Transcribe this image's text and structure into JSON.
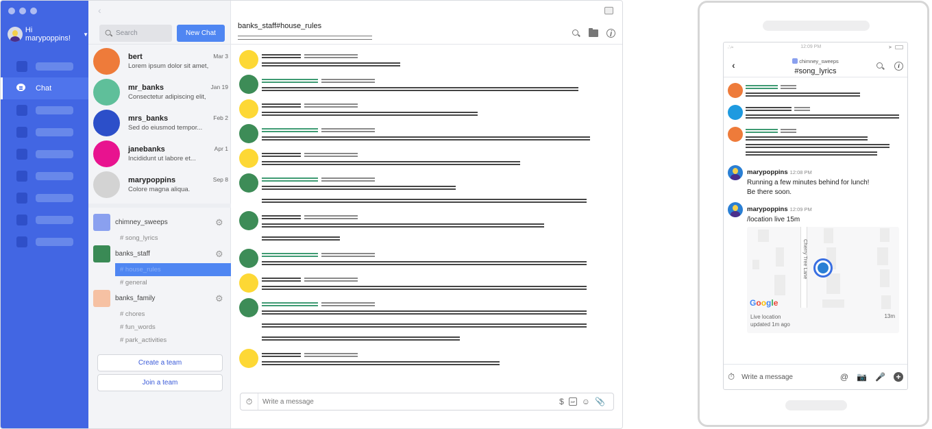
{
  "desktop": {
    "nav": {
      "greeting": "Hi marypoppins!",
      "active_label": "Chat",
      "placeholder_item_count": 9
    },
    "convos": {
      "search_placeholder": "Search",
      "new_chat_label": "New Chat",
      "items": [
        {
          "name": "bert",
          "preview": "Lorem ipsum dolor sit amet,",
          "date": "Mar 3",
          "color": "#ee7b3a"
        },
        {
          "name": "mr_banks",
          "preview": "Consectetur adipiscing elit,",
          "date": "Jan 19",
          "color": "#5fbf9a"
        },
        {
          "name": "mrs_banks",
          "preview": "Sed do eiusmod tempor...",
          "date": "Feb 2",
          "color": "#2c4fc9"
        },
        {
          "name": "janebanks",
          "preview": "Incididunt ut labore et...",
          "date": "Apr 1",
          "color": "#e8138f"
        },
        {
          "name": "marypoppins",
          "preview": "Colore magna aliqua.",
          "date": "Sep 8",
          "color": "#d3d3d3"
        }
      ],
      "teams": [
        {
          "name": "chimney_sweeps",
          "color": "#8aa0ef",
          "channels": [
            "# song_lyrics"
          ]
        },
        {
          "name": "banks_staff",
          "color": "#3a8a55",
          "channels": [
            "# house_rules",
            "# general"
          ],
          "active_channel": "# house_rules"
        },
        {
          "name": "banks_family",
          "color": "#f6c1a3",
          "channels": [
            "# chores",
            "# fun_words",
            "# park_activities"
          ]
        }
      ],
      "create_team_label": "Create a team",
      "join_team_label": "Join a team"
    },
    "main": {
      "channel_title": "banks_staff#house_rules",
      "composer_placeholder": "Write a message"
    }
  },
  "phone": {
    "status_time": "12:09 PM",
    "team_name": "chimney_sweeps",
    "channel_name": "#song_lyrics",
    "messages": [
      {
        "user": "marypoppins",
        "time": "12:08 PM",
        "text_lines": [
          "Running a few minutes behind for lunch!",
          "Be there soon."
        ]
      },
      {
        "user": "marypoppins",
        "time": "12:09 PM",
        "text_lines": [
          "/location live 15m"
        ]
      }
    ],
    "map": {
      "street": "Cherry Tree Lane",
      "provider": "Google",
      "status_line1": "Live location",
      "status_line2": "updated 1m ago",
      "remaining": "13m"
    },
    "composer_placeholder": "Write a message"
  },
  "colors": {
    "nav_blue": "#4266e3",
    "accent_blue": "#4f86f2",
    "yellow_avatar": "#fdd835",
    "green_avatar": "#3d8c57",
    "orange_avatar": "#ee7b3a",
    "blue_avatar": "#1e9ae0"
  }
}
